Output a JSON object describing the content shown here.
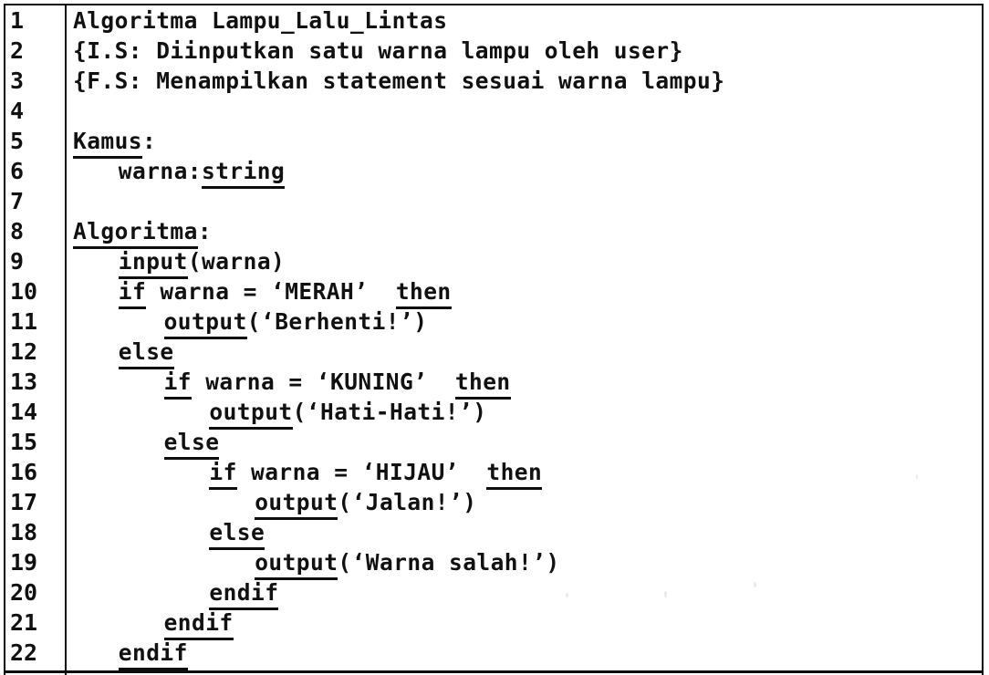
{
  "document": {
    "kind": "pseudocode-listing",
    "language_hint": "Indonesian pseudocode (notasi algoritmik)",
    "title_line": "Algoritma Lampu_Lalu_Lintas",
    "colors": {
      "background": "#ffffff",
      "text": "#111111",
      "border": "#0d0d0d",
      "underline": "#0d0d0d"
    },
    "gutter": {
      "name": "line-number-gutter",
      "first_line": 1,
      "last_line": 22
    }
  },
  "lines": [
    {
      "number": "1",
      "indent": 0,
      "segments": [
        {
          "text": "Algoritma Lampu_Lalu_Lintas",
          "underline": false
        }
      ]
    },
    {
      "number": "2",
      "indent": 0,
      "segments": [
        {
          "text": "{I.S: Diinputkan satu warna lampu oleh user}",
          "underline": false
        }
      ]
    },
    {
      "number": "3",
      "indent": 0,
      "segments": [
        {
          "text": "{F.S: Menampilkan statement sesuai warna lampu}",
          "underline": false
        }
      ]
    },
    {
      "number": "4",
      "indent": 0,
      "segments": []
    },
    {
      "number": "5",
      "indent": 0,
      "segments": [
        {
          "text": "Kamus",
          "underline": true
        },
        {
          "text": ":",
          "underline": false
        }
      ]
    },
    {
      "number": "6",
      "indent": 3,
      "segments": [
        {
          "text": "warna:",
          "underline": false
        },
        {
          "text": "string",
          "underline": true
        }
      ]
    },
    {
      "number": "7",
      "indent": 0,
      "segments": []
    },
    {
      "number": "8",
      "indent": 0,
      "segments": [
        {
          "text": "Algoritma",
          "underline": true
        },
        {
          "text": ":",
          "underline": false
        }
      ]
    },
    {
      "number": "9",
      "indent": 3,
      "segments": [
        {
          "text": "input",
          "underline": true
        },
        {
          "text": "(warna)",
          "underline": false
        }
      ]
    },
    {
      "number": "10",
      "indent": 3,
      "segments": [
        {
          "text": "if",
          "underline": true
        },
        {
          "text": " warna = ‘MERAH’  ",
          "underline": false
        },
        {
          "text": "then",
          "underline": true
        }
      ]
    },
    {
      "number": "11",
      "indent": 6,
      "segments": [
        {
          "text": "output",
          "underline": true
        },
        {
          "text": "(‘Berhenti!’)",
          "underline": false
        }
      ]
    },
    {
      "number": "12",
      "indent": 3,
      "segments": [
        {
          "text": "else",
          "underline": true
        }
      ]
    },
    {
      "number": "13",
      "indent": 6,
      "segments": [
        {
          "text": "if",
          "underline": true
        },
        {
          "text": " warna = ‘KUNING’  ",
          "underline": false
        },
        {
          "text": "then",
          "underline": true
        }
      ]
    },
    {
      "number": "14",
      "indent": 9,
      "segments": [
        {
          "text": "output",
          "underline": true
        },
        {
          "text": "(‘Hati-Hati!’)",
          "underline": false
        }
      ]
    },
    {
      "number": "15",
      "indent": 6,
      "segments": [
        {
          "text": "else",
          "underline": true
        }
      ]
    },
    {
      "number": "16",
      "indent": 9,
      "segments": [
        {
          "text": "if",
          "underline": true
        },
        {
          "text": " warna = ‘HIJAU’  ",
          "underline": false
        },
        {
          "text": "then",
          "underline": true
        }
      ]
    },
    {
      "number": "17",
      "indent": 12,
      "segments": [
        {
          "text": "output",
          "underline": true
        },
        {
          "text": "(‘Jalan!’)",
          "underline": false
        }
      ]
    },
    {
      "number": "18",
      "indent": 9,
      "segments": [
        {
          "text": "else",
          "underline": true
        }
      ]
    },
    {
      "number": "19",
      "indent": 12,
      "segments": [
        {
          "text": "output",
          "underline": true
        },
        {
          "text": "(‘Warna salah!’)",
          "underline": false
        }
      ]
    },
    {
      "number": "20",
      "indent": 9,
      "segments": [
        {
          "text": "endif",
          "underline": true
        }
      ]
    },
    {
      "number": "21",
      "indent": 6,
      "segments": [
        {
          "text": "endif",
          "underline": true
        }
      ]
    },
    {
      "number": "22",
      "indent": 3,
      "segments": [
        {
          "text": "endif",
          "underline": true
        }
      ]
    }
  ]
}
